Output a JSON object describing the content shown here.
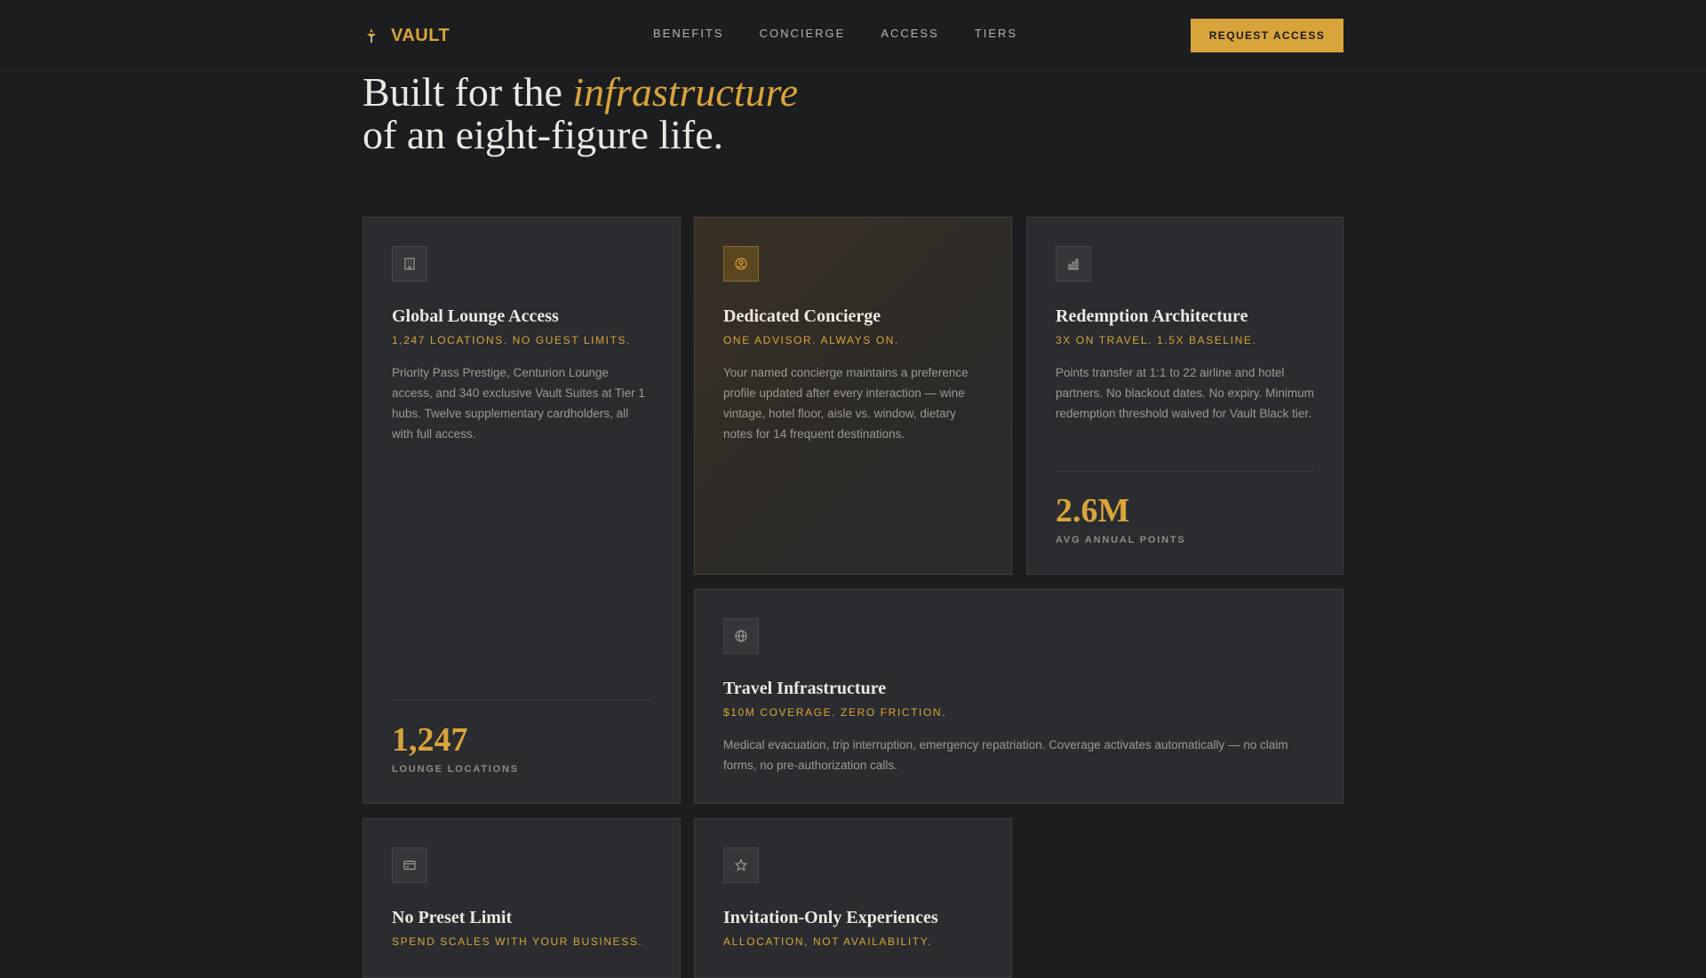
{
  "nav": {
    "brand": "VAULT",
    "links": [
      "BENEFITS",
      "CONCIERGE",
      "ACCESS",
      "TIERS"
    ],
    "cta": "REQUEST ACCESS"
  },
  "hero": {
    "line1_prefix": "Built for the ",
    "line1_emphasis": "infrastructure",
    "line2": "of an eight-figure life."
  },
  "cards": [
    {
      "icon": "building-icon",
      "title": "Global Lounge Access",
      "subtitle": "1,247 LOCATIONS. NO GUEST LIMITS.",
      "body": "Priority Pass Prestige, Centurion Lounge access, and 340 exclusive Vault Suites at Tier 1 hubs. Twelve supplementary cardholders, all with full access.",
      "stat_value": "1,247",
      "stat_label": "LOUNGE LOCATIONS"
    },
    {
      "icon": "user-circle-icon",
      "title": "Dedicated Concierge",
      "subtitle": "ONE ADVISOR. ALWAYS ON.",
      "body": "Your named concierge maintains a preference profile updated after every interaction — wine vintage, hotel floor, aisle vs. window, dietary notes for 14 frequent destinations."
    },
    {
      "icon": "bar-chart-icon",
      "title": "Redemption Architecture",
      "subtitle": "3X ON TRAVEL. 1.5X BASELINE.",
      "body": "Points transfer at 1:1 to 22 airline and hotel partners. No blackout dates. No expiry. Minimum redemption threshold waived for Vault Black tier.",
      "stat_value": "2.6M",
      "stat_label": "AVG ANNUAL POINTS"
    },
    {
      "icon": "globe-icon",
      "title": "Travel Infrastructure",
      "subtitle": "$10M COVERAGE. ZERO FRICTION.",
      "body": "Medical evacuation, trip interruption, emergency repatriation. Coverage activates automatically — no claim forms, no pre-authorization calls."
    },
    {
      "icon": "credit-card-icon",
      "title": "No Preset Limit",
      "subtitle": "SPEND SCALES WITH YOUR BUSINESS."
    },
    {
      "icon": "star-icon",
      "title": "Invitation-Only Experiences",
      "subtitle": "ALLOCATION, NOT AVAILABILITY."
    }
  ],
  "colors": {
    "accent": "#d9a43a",
    "background": "#1c1d1f",
    "card": "#2a2c2f"
  }
}
